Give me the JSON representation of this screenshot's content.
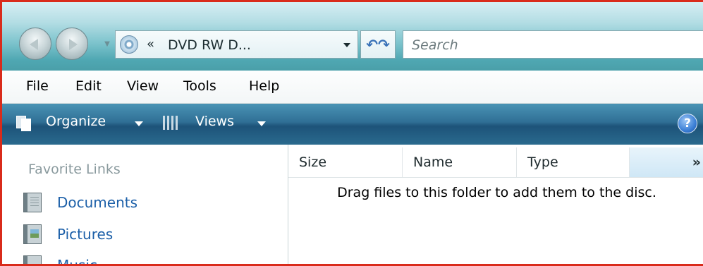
{
  "address_bar": {
    "location_chevron": "«",
    "location_text": "DVD RW D...",
    "refresh_glyph": "↶↷",
    "search_placeholder": "Search"
  },
  "menu": {
    "items": [
      "File",
      "Edit",
      "View",
      "Tools",
      "Help"
    ]
  },
  "command_bar": {
    "organize_label": "Organize",
    "views_label": "Views",
    "help_glyph": "?"
  },
  "nav_pane": {
    "heading": "Favorite Links",
    "links": [
      "Documents",
      "Pictures",
      "Music"
    ]
  },
  "file_list": {
    "columns": [
      "Size",
      "Name",
      "Type"
    ],
    "more_columns_glyph": "»",
    "empty_message": "Drag files to this folder to add them to the disc."
  },
  "colors": {
    "frame_border": "#d92b1b",
    "link": "#1b5fa8",
    "command_bar": "#2f6f95"
  }
}
